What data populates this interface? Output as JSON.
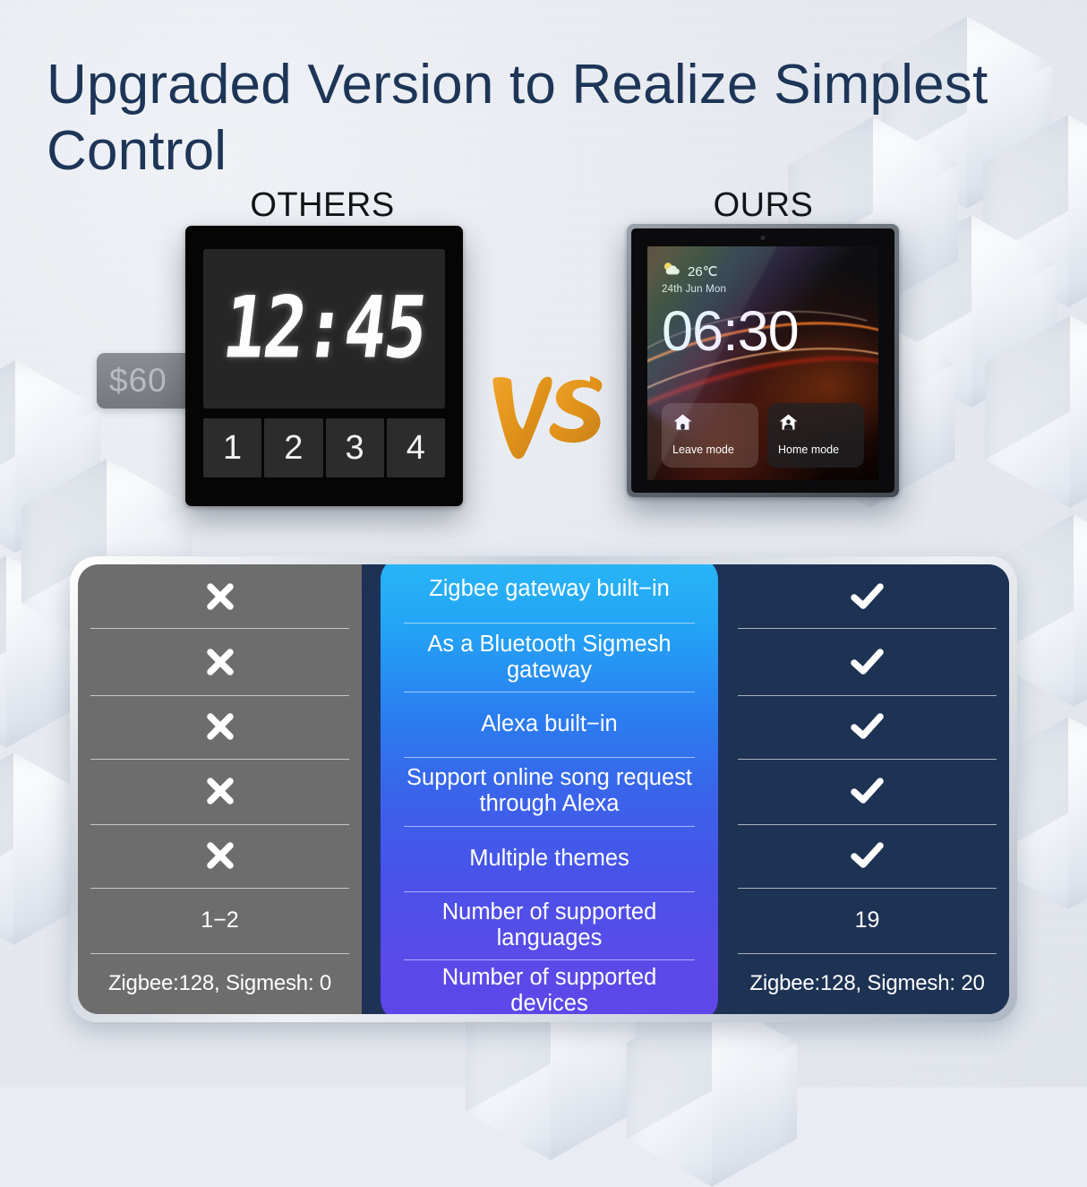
{
  "title": "Upgraded Version to Realize Simplest Control",
  "columns": {
    "others_label": "OTHERS",
    "ours_label": "OURS"
  },
  "vs_label": "VS",
  "device_others": {
    "price_tag": "$60",
    "clock": "12:45",
    "buttons": [
      "1",
      "2",
      "3",
      "4"
    ]
  },
  "device_ours": {
    "weather_icon": "sun-behind-cloud-icon",
    "temperature": "26℃",
    "date": "24th Jun Mon",
    "clock": "06:30",
    "modes": [
      {
        "icon": "house-icon",
        "label": "Leave mode"
      },
      {
        "icon": "house-person-icon",
        "label": "Home mode"
      }
    ]
  },
  "comparison": {
    "rows": [
      {
        "feature": "Zigbee gateway built−in",
        "others": "×",
        "others_type": "x",
        "ours": "✓",
        "ours_type": "check"
      },
      {
        "feature": "As a Bluetooth Sigmesh gateway",
        "others": "×",
        "others_type": "x",
        "ours": "✓",
        "ours_type": "check"
      },
      {
        "feature": "Alexa built−in",
        "others": "×",
        "others_type": "x",
        "ours": "✓",
        "ours_type": "check"
      },
      {
        "feature": "Support online song request through Alexa",
        "others": "×",
        "others_type": "x",
        "ours": "✓",
        "ours_type": "check"
      },
      {
        "feature": "Multiple themes",
        "others": "×",
        "others_type": "x",
        "ours": "✓",
        "ours_type": "check"
      },
      {
        "feature": "Number of supported languages",
        "others": "1−2",
        "others_type": "text",
        "ours": "19",
        "ours_type": "text"
      },
      {
        "feature": "Number of supported devices",
        "others": "Zigbee:128, Sigmesh: 0",
        "others_type": "text-small",
        "ours": "Zigbee:128, Sigmesh: 20",
        "ours_type": "text-small"
      }
    ]
  },
  "colors": {
    "title": "#1d3557",
    "others_column": "#6d6d6d",
    "ours_column": "#1e3254",
    "center_top": "#29b6f6",
    "center_bottom": "#5b4ae8",
    "vs_accent": "#e39a22"
  }
}
